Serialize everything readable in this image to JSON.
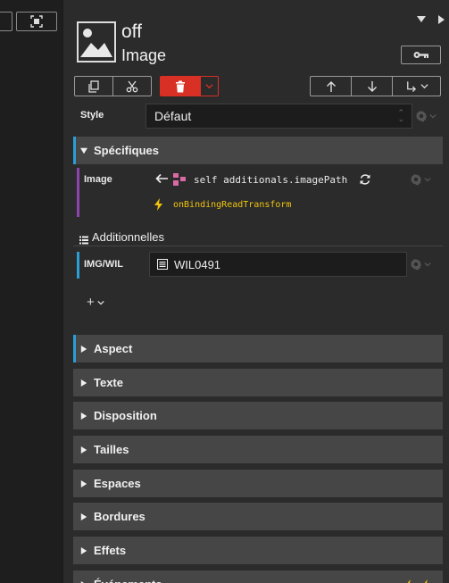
{
  "object": {
    "name": "off",
    "type": "Image"
  },
  "style": {
    "label": "Style",
    "value": "Défaut"
  },
  "specifics": {
    "title": "Spécifiques",
    "image_label": "Image",
    "binding_path": "self additionals.imagePath",
    "transform": "onBindingReadTransform"
  },
  "additionals": {
    "title": "Additionnelles",
    "field_label": "IMG/WIL",
    "field_value": "WIL0491"
  },
  "add_button": "+",
  "sections": [
    {
      "label": "Aspect",
      "active": true
    },
    {
      "label": "Texte",
      "active": false
    },
    {
      "label": "Disposition",
      "active": false
    },
    {
      "label": "Tailles",
      "active": false
    },
    {
      "label": "Espaces",
      "active": false
    },
    {
      "label": "Bordures",
      "active": false
    },
    {
      "label": "Effets",
      "active": false
    },
    {
      "label": "Événements",
      "active": false
    }
  ],
  "icons": {
    "copy": "copy-icon",
    "cut": "scissors-icon",
    "delete": "trash-icon",
    "up": "arrow-up-icon",
    "down": "arrow-down-icon",
    "reparent": "reparent-icon",
    "key": "key-icon",
    "gear": "gear-icon",
    "refresh": "refresh-icon",
    "bolt": "bolt-icon"
  },
  "colors": {
    "panel": "#2b2b2b",
    "section": "#464646",
    "accent_blue": "#2a9fd6",
    "binding_purple": "#8e44ad",
    "delete_red": "#d93025",
    "event_yellow": "#f1c40f"
  }
}
